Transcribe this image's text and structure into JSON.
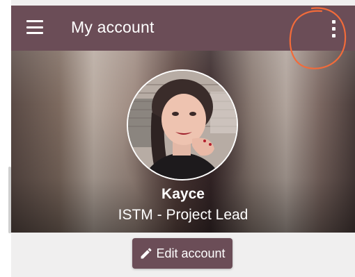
{
  "appbar": {
    "title": "My account",
    "menu_icon": "hamburger-menu-icon",
    "overflow_icon": "more-vert-icon",
    "color": "#6b4d57"
  },
  "annotation": {
    "shape": "hand-drawn circle",
    "color": "#f26b3a"
  },
  "profile": {
    "name": "Kayce",
    "role": "ISTM - Project Lead",
    "avatar_icon": "profile-photo"
  },
  "actions": {
    "edit_label": "Edit account",
    "edit_icon": "pencil-icon"
  }
}
